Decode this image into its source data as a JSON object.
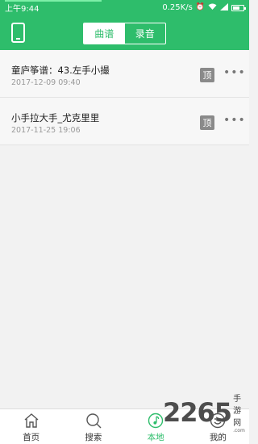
{
  "status_bar": {
    "time": "上午9:44",
    "speed": "0.25K/s"
  },
  "header": {
    "segments": [
      {
        "label": "曲谱",
        "active": true
      },
      {
        "label": "录音",
        "active": false
      }
    ]
  },
  "list": [
    {
      "title": "童庐筝谱：43.左手小撮",
      "date": "2017-12-09 09:40",
      "pin_label": "顶",
      "more_label": "•••"
    },
    {
      "title": "小手拉大手_尤克里里",
      "date": "2017-11-25 19:06",
      "pin_label": "顶",
      "more_label": "•••"
    }
  ],
  "tabbar": {
    "tabs": [
      {
        "label": "首页",
        "icon": "home-icon"
      },
      {
        "label": "搜索",
        "icon": "search-icon"
      },
      {
        "label": "本地",
        "icon": "music-note-icon",
        "active": true
      },
      {
        "label": "我的",
        "icon": "smiley-icon"
      }
    ]
  },
  "watermark": {
    "number": "2265",
    "text": "手游网",
    "url": ".com"
  },
  "colors": {
    "primary": "#2ebd6b"
  }
}
